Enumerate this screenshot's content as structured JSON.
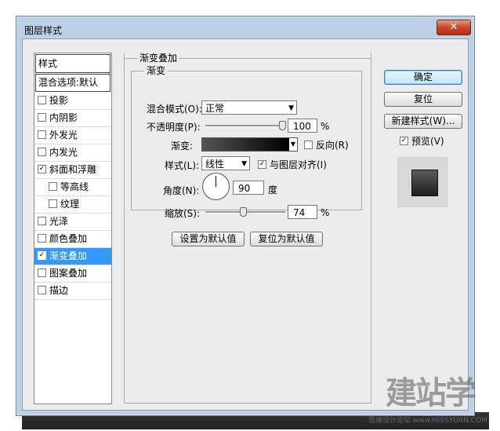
{
  "window": {
    "title": "图层样式",
    "close": "✕"
  },
  "sidebar": {
    "header": "样式",
    "blend_options": "混合选项:默认",
    "items": [
      {
        "label": "投影",
        "checked": false
      },
      {
        "label": "内阴影",
        "checked": false
      },
      {
        "label": "外发光",
        "checked": false
      },
      {
        "label": "内发光",
        "checked": false
      },
      {
        "label": "斜面和浮雕",
        "checked": true
      },
      {
        "label": "等高线",
        "checked": false
      },
      {
        "label": "纹理",
        "checked": false
      },
      {
        "label": "光泽",
        "checked": false
      },
      {
        "label": "颜色叠加",
        "checked": false
      },
      {
        "label": "渐变叠加",
        "checked": true
      },
      {
        "label": "图案叠加",
        "checked": false
      },
      {
        "label": "描边",
        "checked": false
      }
    ]
  },
  "panel": {
    "group_title": "渐变叠加",
    "inner_title": "渐变",
    "blend_mode_label": "混合模式(O):",
    "blend_mode_value": "正常",
    "opacity_label": "不透明度(P):",
    "opacity_value": "100",
    "opacity_unit": "%",
    "gradient_label": "渐变:",
    "reverse_label": "反向(R)",
    "reverse_checked": false,
    "style_label": "样式(L):",
    "style_value": "线性",
    "align_label": "与图层对齐(I)",
    "align_checked": true,
    "angle_label": "角度(N):",
    "angle_value": "90",
    "angle_unit": "度",
    "scale_label": "缩放(S):",
    "scale_value": "74",
    "scale_unit": "%",
    "make_default": "设置为默认值",
    "reset_default": "复位为默认值"
  },
  "actions": {
    "ok": "确定",
    "reset": "复位",
    "new_style": "新建样式(W)...",
    "preview_label": "预览(V)",
    "preview_checked": true
  },
  "watermark": {
    "main": "建站学",
    "sub": "思缘设计论坛 www.MISSYUAN.COM"
  },
  "check_mark": "✓",
  "dropdown_arrow": "▼"
}
